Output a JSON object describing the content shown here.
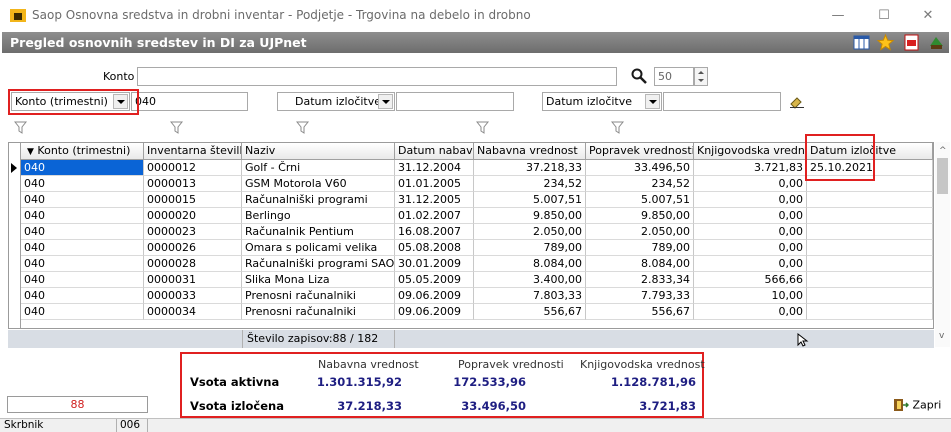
{
  "window": {
    "title": "Saop Osnovna sredstva in drobni inventar  - Podjetje - Trgovina na debelo in drobno",
    "minimize": "—",
    "maximize": "☐",
    "close": "✕"
  },
  "module": {
    "title": "Pregled osnovnih sredstev in DI za UJPnet",
    "icons": [
      "grid-icon",
      "star-icon",
      "pdf-icon",
      "exit-icon"
    ]
  },
  "filters": {
    "konto_label": "Konto",
    "konto_value": "",
    "limit_value": "50",
    "combo1_label": "Konto (trimestni)",
    "combo1_value": "040",
    "combo2_label": "Datum izločitve",
    "combo2_value": "",
    "combo3_label": "Datum izločitve",
    "combo3_value": ""
  },
  "grid": {
    "columns": [
      "Konto (trimestni)",
      "Inventarna številka",
      "Naziv",
      "Datum nabave",
      "Nabavna vrednost",
      "Popravek vrednosti",
      "Knjigovodska vrednost",
      "Datum izločitve"
    ],
    "rows": [
      [
        "040",
        "0000012",
        "Golf - Črni",
        "31.12.2004",
        "37.218,33",
        "33.496,50",
        "3.721,83",
        "25.10.2021"
      ],
      [
        "040",
        "0000013",
        "GSM Motorola V60",
        "01.01.2005",
        "234,52",
        "234,52",
        "0,00",
        ""
      ],
      [
        "040",
        "0000015",
        "Računalniški programi",
        "31.12.2005",
        "5.007,51",
        "5.007,51",
        "0,00",
        ""
      ],
      [
        "040",
        "0000020",
        "Berlingo",
        "01.02.2007",
        "9.850,00",
        "9.850,00",
        "0,00",
        ""
      ],
      [
        "040",
        "0000023",
        "Računalnik Pentium",
        "16.08.2007",
        "2.050,00",
        "2.050,00",
        "0,00",
        ""
      ],
      [
        "040",
        "0000026",
        "Omara s policami velika",
        "05.08.2008",
        "789,00",
        "789,00",
        "0,00",
        ""
      ],
      [
        "040",
        "0000028",
        "Računalniški programi SAOP",
        "30.01.2009",
        "8.084,00",
        "8.084,00",
        "0,00",
        ""
      ],
      [
        "040",
        "0000031",
        "Slika  Mona Liza",
        "05.05.2009",
        "3.400,00",
        "2.833,34",
        "566,66",
        ""
      ],
      [
        "040",
        "0000033",
        "Prenosni računalniki",
        "09.06.2009",
        "7.803,33",
        "7.793,33",
        "10,00",
        ""
      ],
      [
        "040",
        "0000034",
        "Prenosni računalniki",
        "09.06.2009",
        "556,67",
        "556,67",
        "0,00",
        ""
      ]
    ],
    "record_count": "Število zapisov:88 / 182"
  },
  "totals": {
    "headers": [
      "Nabavna vrednost",
      "Popravek vrednosti",
      "Knjigovodska vrednost"
    ],
    "active_label": "Vsota aktivna",
    "active_values": [
      "1.301.315,92",
      "172.533,96",
      "1.128.781,96"
    ],
    "removed_label": "Vsota izločena",
    "removed_values": [
      "37.218,33",
      "33.496,50",
      "3.721,83"
    ],
    "count": "88",
    "close_label": "Zapri"
  },
  "footer": {
    "user": "Skrbnik",
    "code": "006"
  }
}
